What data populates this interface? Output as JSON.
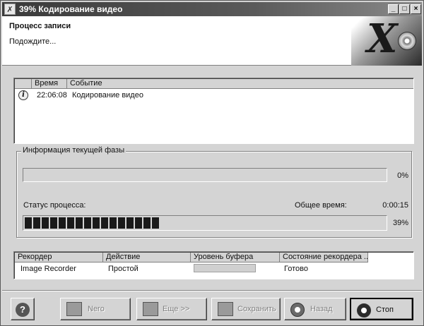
{
  "window": {
    "title": "39% Кодирование видео",
    "controls": {
      "minimize": "_",
      "maximize": "□",
      "close": "×"
    }
  },
  "header": {
    "title": "Процесс записи",
    "subtitle": "Подождите..."
  },
  "log": {
    "columns": [
      "",
      "Время",
      "Событие"
    ],
    "rows": [
      {
        "icon": "info-icon",
        "time": "22:06:08",
        "event": "Кодирование видео"
      }
    ]
  },
  "phase": {
    "legend": "Информация текущей фазы",
    "phase_progress_label": "0%",
    "phase_progress": 0,
    "status_label": "Статус процесса:",
    "total_time_label": "Общее время:",
    "total_time": "0:00:15",
    "overall_progress_label": "39%",
    "overall_progress": 0.39
  },
  "recorders": {
    "columns": [
      "Рекордер",
      "Действие",
      "Уровень буфера",
      "Состояние рекордера ..."
    ],
    "rows": [
      {
        "recorder": "Image Recorder",
        "action": "Простой",
        "buffer_level": 0,
        "state": "Готово"
      }
    ]
  },
  "buttons": {
    "help": "?",
    "nero": "Nero",
    "more": "Еще >>",
    "save": "Сохранить",
    "back": "Назад",
    "stop": "Стоп"
  },
  "colors": {
    "titlebar": "#3a3a3a",
    "face": "#d4d4d4",
    "progress_fill": "#1a1a1a"
  }
}
